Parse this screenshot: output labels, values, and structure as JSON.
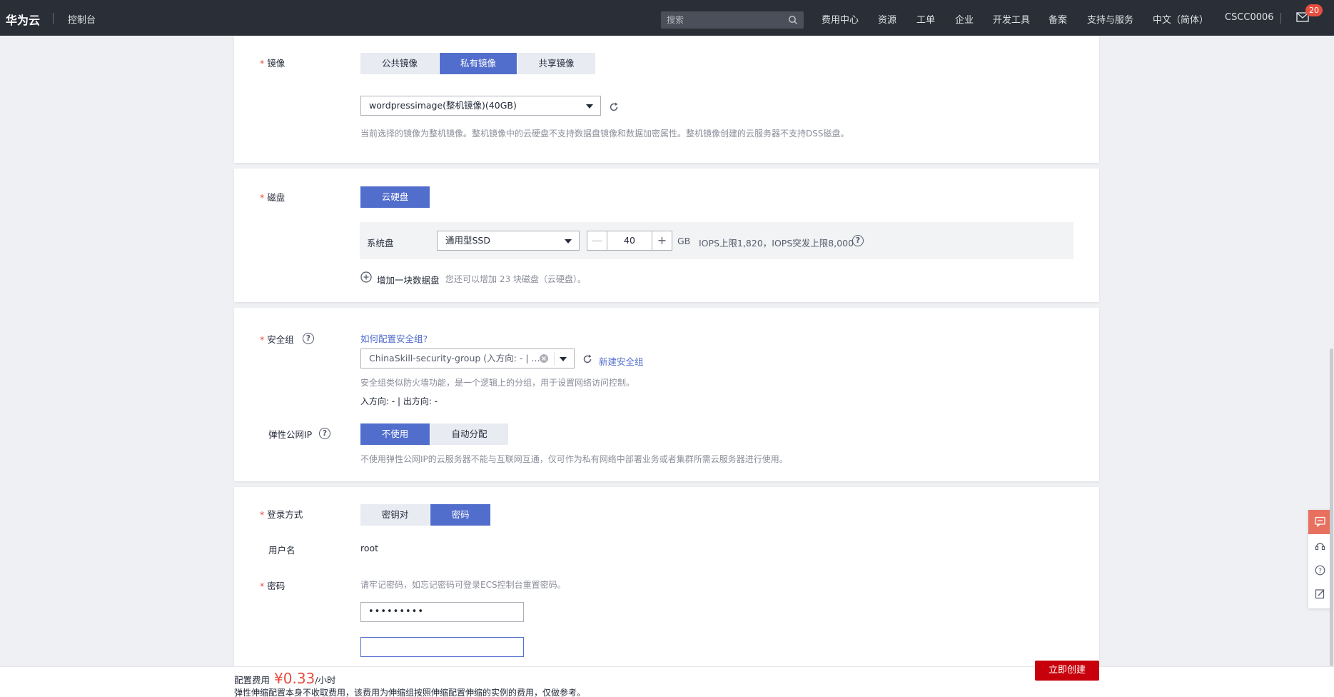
{
  "topbar": {
    "brand": "华为云",
    "console": "控制台",
    "search_placeholder": "搜索",
    "nav": [
      "费用中心",
      "资源",
      "工单",
      "企业",
      "开发工具",
      "备案",
      "支持与服务",
      "中文（简体）",
      "CSCC0006"
    ],
    "mail_badge": "20"
  },
  "image_section": {
    "label": "镜像",
    "tabs": [
      "公共镜像",
      "私有镜像",
      "共享镜像"
    ],
    "active_tab": "私有镜像",
    "selected_image": "wordpressimage(整机镜像)(40GB)",
    "hint": "当前选择的镜像为整机镜像。整机镜像中的云硬盘不支持数据盘镜像和数据加密属性。整机镜像创建的云服务器不支持DSS磁盘。"
  },
  "disk_section": {
    "label": "磁盘",
    "type_button": "云硬盘",
    "system_disk_label": "系统盘",
    "disk_type": "通用型SSD",
    "size": "40",
    "unit": "GB",
    "iops": "IOPS上限1,820，IOPS突发上限8,000",
    "add_data_disk": "增加一块数据盘",
    "add_hint": "您还可以增加 23 块磁盘（云硬盘）。"
  },
  "security_section": {
    "label": "安全组",
    "how_link": "如何配置安全组?",
    "selected_group": "ChinaSkill-security-group (入方向: - | ...",
    "new_group_link": "新建安全组",
    "hint": "安全组类似防火墙功能，是一个逻辑上的分组，用于设置网络访问控制。",
    "direction": "入方向: - | 出方向: -",
    "eip_label": "弹性公网IP",
    "eip_options": [
      "不使用",
      "自动分配"
    ],
    "eip_active": "不使用",
    "eip_hint": "不使用弹性公网IP的云服务器不能与互联网互通，仅可作为私有网络中部署业务或者集群所需云服务器进行使用。"
  },
  "login_section": {
    "label": "登录方式",
    "options": [
      "密钥对",
      "密码"
    ],
    "active": "密码",
    "username_label": "用户名",
    "username": "root",
    "password_label": "密码",
    "password_hint": "请牢记密码，如忘记密码可登录ECS控制台重置密码。",
    "password_value": "•••••••••"
  },
  "footer": {
    "fee_label": "配置费用",
    "price": "¥0.33",
    "unit": "/小时",
    "note": "弹性伸缩配置本身不收取费用，该费用为伸缩组按照伸缩配置伸缩的实例的费用，仅做参考。",
    "create_button": "立即创建"
  },
  "colors": {
    "accent": "#526ecc",
    "danger": "#c7000b",
    "topbar": "#2a2e36"
  }
}
